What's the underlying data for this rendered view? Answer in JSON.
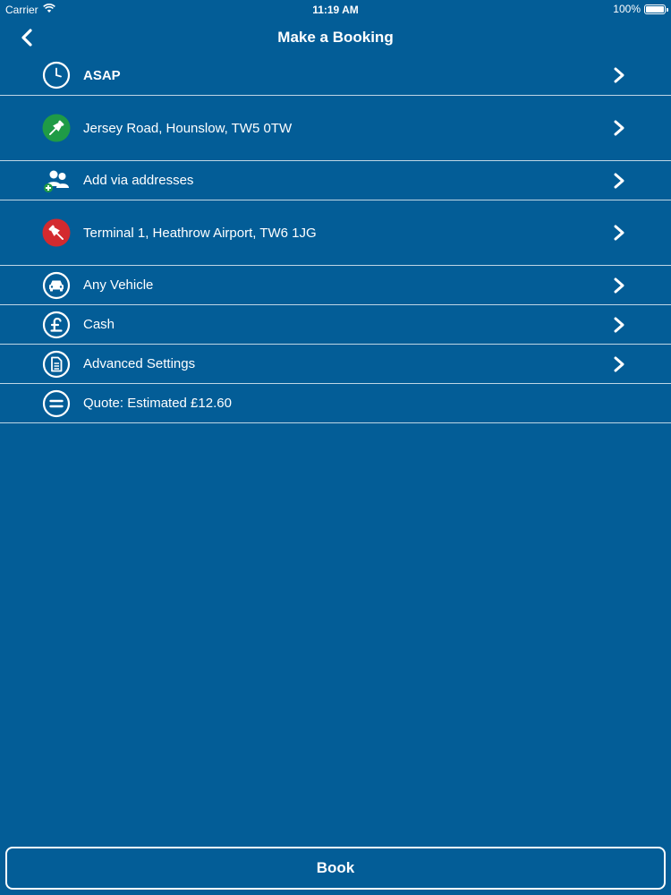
{
  "status_bar": {
    "carrier": "Carrier",
    "time": "11:19 AM",
    "battery": "100%",
    "battery_level": 1.0
  },
  "nav": {
    "title": "Make a Booking",
    "back_icon": "chevron-left-icon"
  },
  "rows": [
    {
      "label": "ASAP",
      "icon": "clock-icon"
    },
    {
      "label": "Jersey Road, Hounslow, TW5 0TW",
      "icon": "pickup-pin-icon"
    },
    {
      "label": "Add via addresses",
      "icon": "add-people-icon"
    },
    {
      "label": "Terminal 1, Heathrow Airport, TW6 1JG",
      "icon": "dropoff-pin-icon"
    },
    {
      "label": "Any Vehicle",
      "icon": "car-icon"
    },
    {
      "label": "Cash",
      "icon": "pound-icon"
    },
    {
      "label": "Advanced Settings",
      "icon": "document-icon"
    },
    {
      "label": "Quote: Estimated £12.60",
      "icon": "menu-icon"
    }
  ],
  "book_button": {
    "label": "Book"
  },
  "colors": {
    "background": "#035d97",
    "text": "#ffffff",
    "pickup_pin": "#1f9b46",
    "dropoff_pin": "#d32a2f",
    "separator": "#ffffff"
  }
}
